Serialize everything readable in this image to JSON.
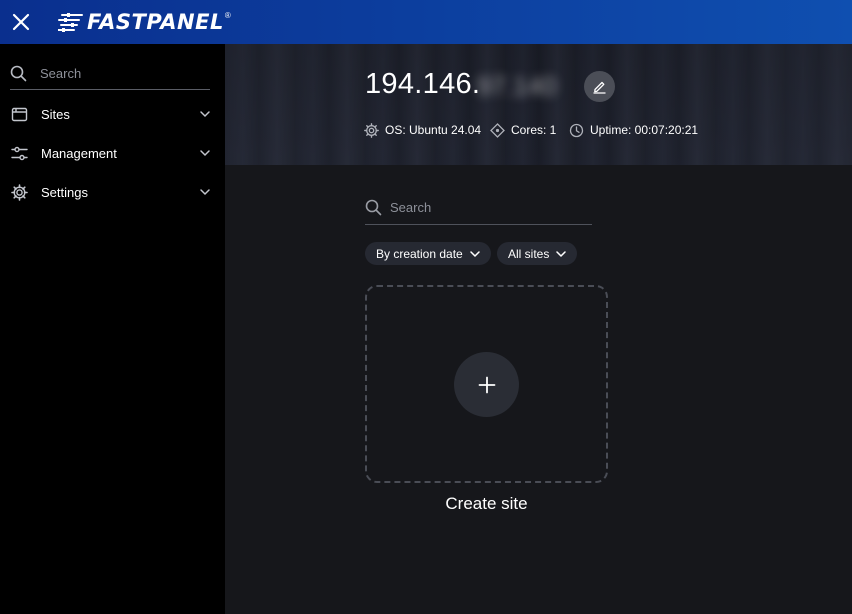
{
  "brand": {
    "name": "FASTPANEL",
    "registered_mark": "®"
  },
  "sidebar": {
    "search_placeholder": "Search",
    "items": [
      {
        "label": "Sites",
        "icon": "browser-window-icon"
      },
      {
        "label": "Management",
        "icon": "sliders-icon"
      },
      {
        "label": "Settings",
        "icon": "gear-icon"
      }
    ]
  },
  "server": {
    "ip_visible": "194.146.",
    "ip_obscured": "97.140",
    "os": "OS: Ubuntu 24.04",
    "cores": "Cores: 1",
    "uptime": "Uptime: 00:07:20:21"
  },
  "main": {
    "search_placeholder": "Search",
    "sort_label": "By creation date",
    "filter_label": "All sites",
    "create_label": "Create site",
    "plus_symbol": "+"
  },
  "colors": {
    "topbar": "#0c3d9d",
    "sidebar_bg": "#000000",
    "main_bg": "#16171b",
    "pill_bg": "#262932"
  }
}
